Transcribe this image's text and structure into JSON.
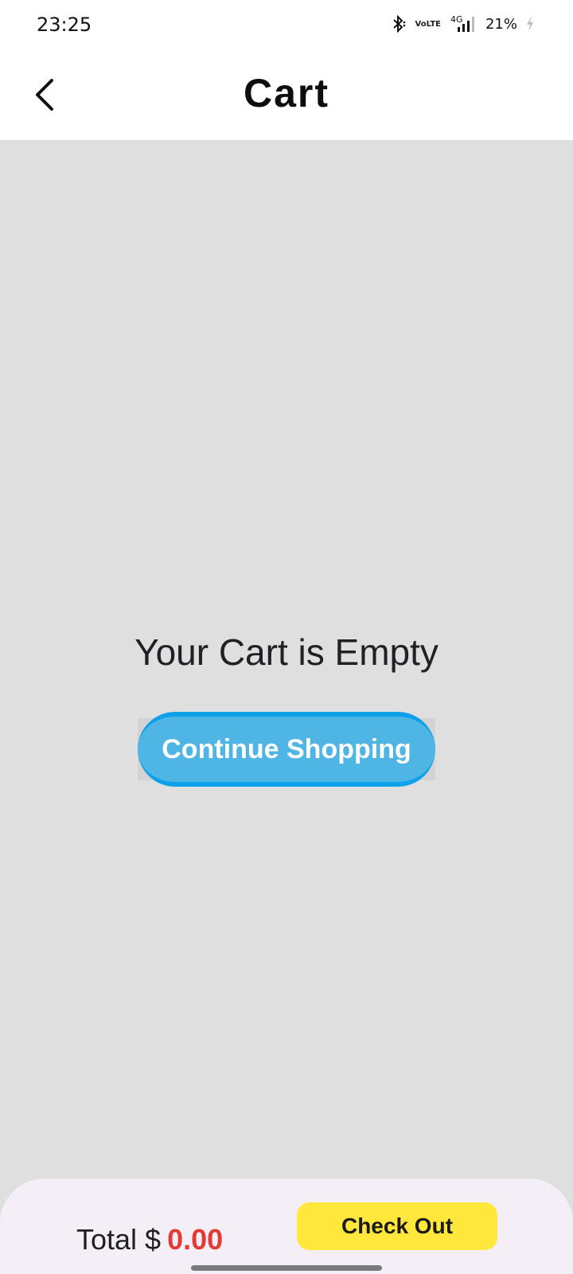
{
  "status_bar": {
    "time": "23:25",
    "volte_top": "Vo",
    "volte_bottom": "LTE",
    "network": "4G",
    "battery": "21%",
    "icons": [
      "bluetooth-icon",
      "volte-icon",
      "signal-icon",
      "battery-charging-icon"
    ]
  },
  "app_bar": {
    "title": "Cart",
    "back_icon": "chevron-left-icon"
  },
  "main": {
    "empty_message": "Your Cart is Empty",
    "continue_label": "Continue Shopping"
  },
  "footer": {
    "total_label": "Total $",
    "total_value": "0.00",
    "checkout_label": "Check Out"
  },
  "colors": {
    "background": "#dfdfe0",
    "continue_button": "#4fb5e4",
    "continue_border": "#0da1ea",
    "total_value": "#e53935",
    "checkout_button": "#ffe83b",
    "bottom_bar": "#f4eff6"
  }
}
